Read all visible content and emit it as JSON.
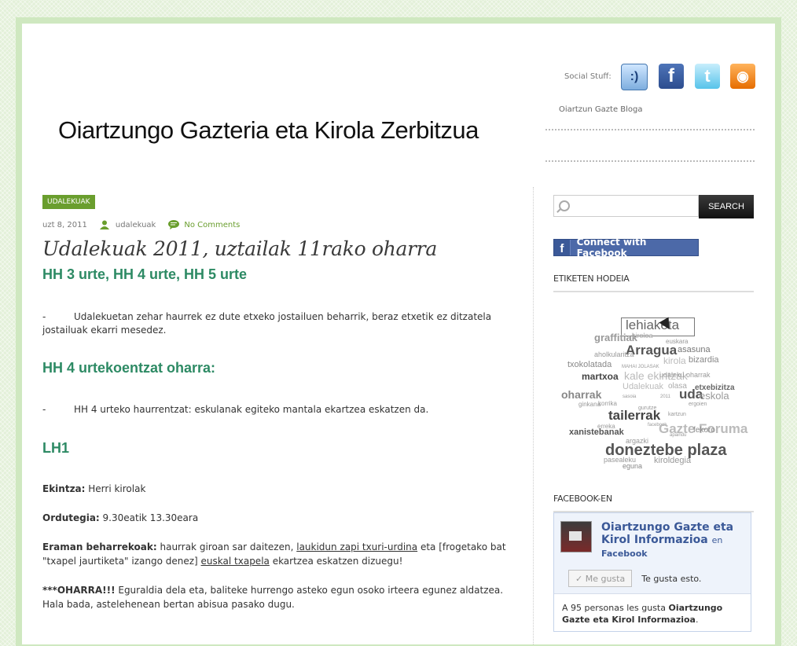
{
  "header": {
    "site_title": "Oiartzungo Gazteria eta Kirola Zerbitzua",
    "social_label": "Social Stuff:",
    "tagline": "Oiartzun Gazte Bloga"
  },
  "post": {
    "category": "UDALEKUAK",
    "date": "uzt 8, 2011",
    "author": "udalekuak",
    "comments": "No Comments",
    "title": "Udalekuak 2011, uztailak 11rako oharra",
    "section1_heading": "HH 3 urte, HH 4 urte, HH 5 urte",
    "bullet1_dash": "-",
    "bullet1": "Udalekuetan zehar haurrek ez dute etxeko jostailuen beharrik, beraz etxetik ez ditzatela jostailuak ekarri mesedez.",
    "section2_heading": "HH 4 urtekoentzat oharra:",
    "bullet2_dash": "-",
    "bullet2": "HH 4 urteko haurrentzat: eskulanak egiteko mantala ekartzea eskatzen da.",
    "section3_heading": "LH1",
    "ekintza_label": "Ekintza:",
    "ekintza_value": " Herri kirolak",
    "ordutegia_label": "Ordutegia:",
    "ordutegia_value": " 9.30eatik 13.30eara",
    "eraman_label": "Eraman beharrekoak:",
    "eraman_text1": " haurrak giroan sar daitezen, ",
    "eraman_link1": "laukidun zapi txuri-urdina",
    "eraman_text2": " eta [frogetako bat \"txapel jaurtiketa\" izango denez] ",
    "eraman_link2": "euskal txapela",
    "eraman_text3": " ekartzea eskatzen dizuegu!",
    "oharra_label": "***OHARRA!!!",
    "oharra_text": " Eguraldia dela eta, baliteke hurrengo asteko egun osoko irteera egunez aldatzea. Hala bada, astelehenean bertan abisua pasako dugu."
  },
  "sidebar": {
    "search_button": "SEARCH",
    "search_placeholder": "",
    "fb_connect": "Connect with Facebook",
    "tag_cloud_title": "ETIKETEN HODEIA",
    "tags": [
      "lehiaketa",
      "graffitiak",
      "Arragua",
      "euskara",
      "asasuna",
      "aholkularitza",
      "kirola",
      "bizardia",
      "txokolatada",
      "MAHAI JOLASAK",
      "martxoa",
      "kale ekintzak",
      "udaleku oharrak",
      "oharrak",
      "Udalekuak",
      "olasa",
      "uda",
      "etxebizitza",
      "eskola",
      "ginkana",
      "ergoien",
      "tailerrak",
      "gurutze",
      "kartzun",
      "xanistebanak",
      "erreka",
      "Gazte Foruma",
      "fekoro",
      "argazki",
      "apaindu",
      "doneztebe plaza",
      "pasealeku",
      "kiroldegia",
      "eguna",
      "2011",
      "korrika",
      "sasoia",
      "facebook",
      "kiroloa"
    ],
    "facebook_title": "FACEBOOK-EN",
    "fb_page_name": "Oiartzungo Gazte eta Kirol Informazioa",
    "fb_en": "en",
    "fb_facebook": "Facebook",
    "fb_like_button": "Me gusta",
    "fb_like_text": "Te gusta esto.",
    "fb_count_text": "A 95 personas les gusta ",
    "fb_count_name": "Oiartzungo Gazte eta Kirol Informazioa",
    "fb_count_end": "."
  },
  "colors": {
    "accent_green": "#6a9e2e",
    "heading_green": "#2d8a64",
    "facebook_blue": "#3b5998"
  }
}
